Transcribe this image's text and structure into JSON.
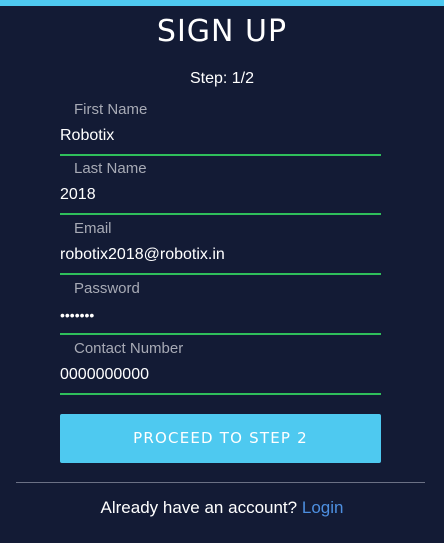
{
  "page": {
    "title": "SIGN UP",
    "step": "Step: 1/2"
  },
  "form": {
    "first_name": {
      "label": "First Name",
      "value": "Robotix"
    },
    "last_name": {
      "label": "Last Name",
      "value": "2018"
    },
    "email": {
      "label": "Email",
      "value": "robotix2018@robotix.in"
    },
    "password": {
      "label": "Password",
      "value": "•••••••"
    },
    "contact": {
      "label": "Contact Number",
      "value": "0000000000"
    },
    "proceed_label": "PROCEED TO STEP 2"
  },
  "footer": {
    "prompt": "Already have an account?",
    "login_label": "Login"
  },
  "colors": {
    "background": "#131b35",
    "accent": "#4ec9f0",
    "underline": "#2fbf5b",
    "link": "#4d8fe0"
  }
}
